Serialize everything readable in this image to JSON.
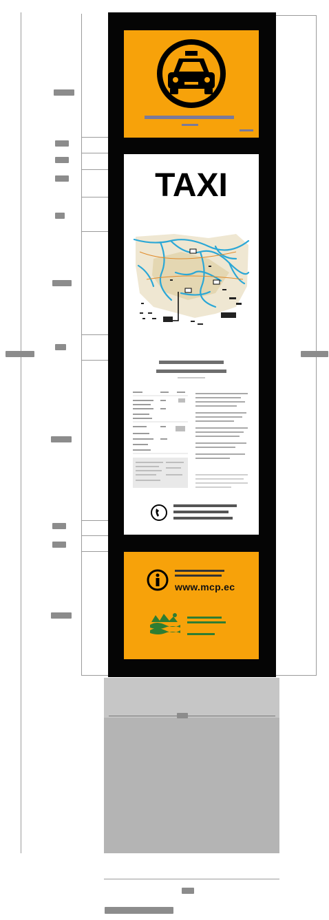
{
  "sign": {
    "title": "TAXI",
    "website": "www.mcp.ec",
    "pictogram": "taxi-car-icon",
    "info_icon": "info-icon",
    "phone_icon": "phone-icon"
  },
  "colors": {
    "orange": "#f7a20a",
    "pole": "#050505",
    "base": "#b4b4b4",
    "map_water": "#2aa7d6"
  }
}
